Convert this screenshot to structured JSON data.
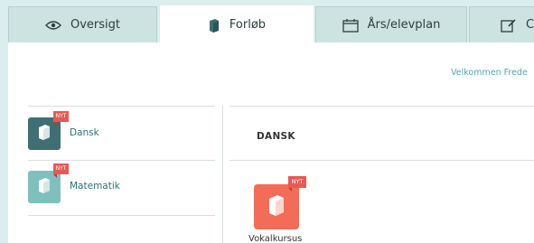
{
  "tabs": [
    {
      "label": "Oversigt",
      "icon": "eye-icon"
    },
    {
      "label": "Forløb",
      "icon": "book-icon",
      "active": true
    },
    {
      "label": "Års/elevplan",
      "icon": "calendar-icon"
    },
    {
      "label": "C",
      "icon": "edit-note-icon"
    }
  ],
  "header": {
    "welcome": "Velkommen Frede"
  },
  "sidebar": {
    "items": [
      {
        "label": "Dansk",
        "badge": "NYT",
        "tile_color": "#3f6f72"
      },
      {
        "label": "Matematik",
        "badge": "NYT",
        "tile_color": "#7fbfbe"
      }
    ]
  },
  "main": {
    "title": "DANSK",
    "courses": [
      {
        "label": "Vokalkursus",
        "badge": "NYT",
        "tile_color": "#f26c58"
      }
    ]
  },
  "colors": {
    "background": "#dbeeee",
    "badge": "#e65a53",
    "link": "#4fa8ad"
  }
}
